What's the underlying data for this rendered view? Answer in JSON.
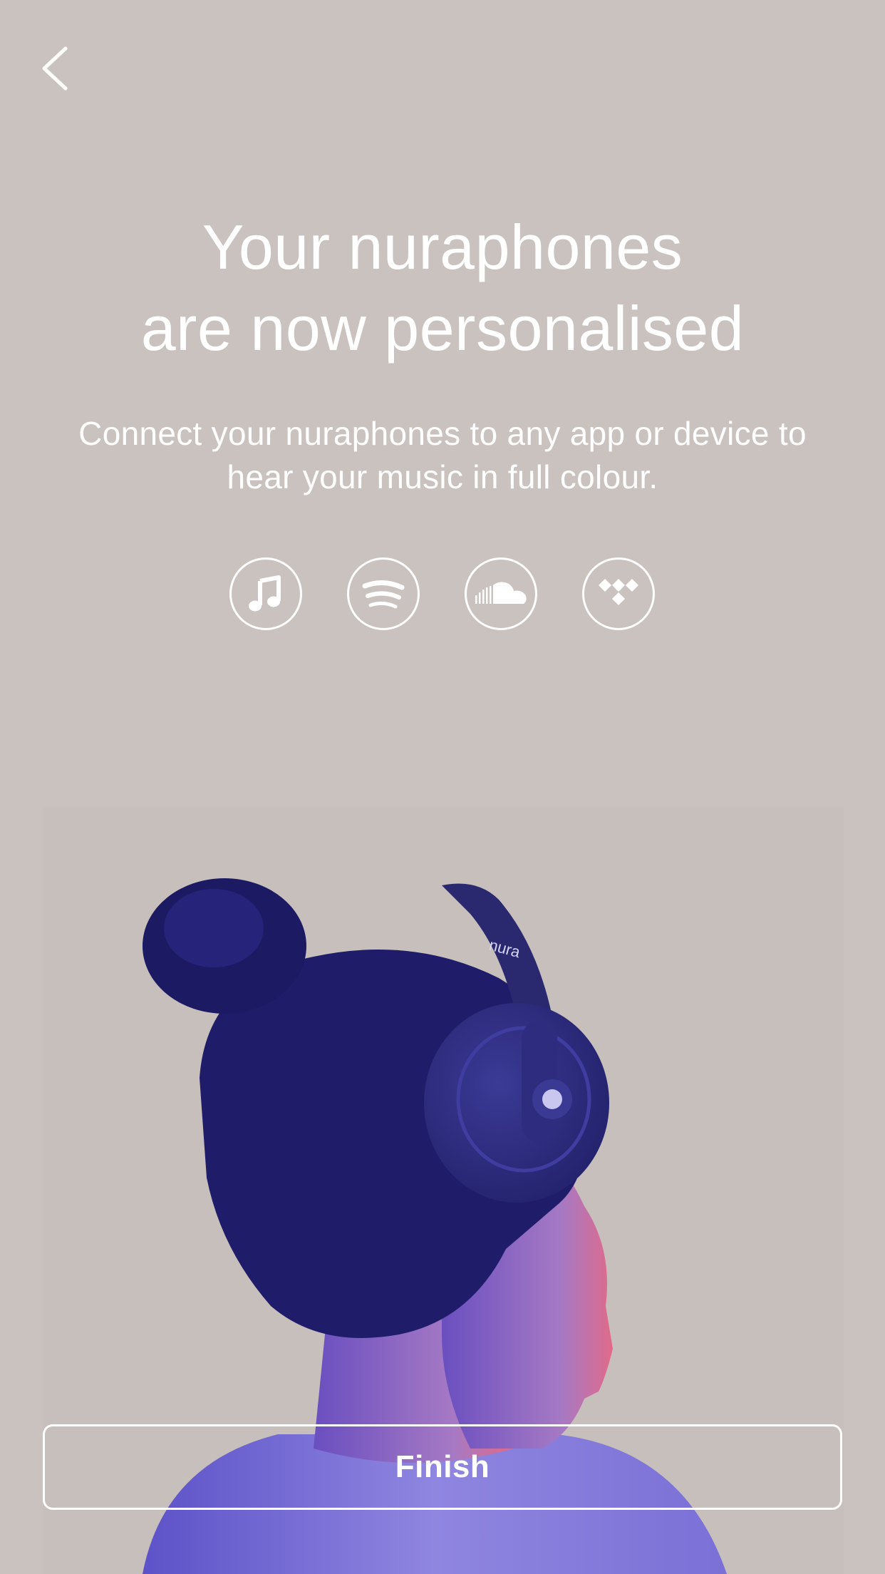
{
  "header": {
    "back_icon": "chevron-left-icon"
  },
  "title": {
    "line1": "Your nuraphones",
    "line2": "are now personalised"
  },
  "subtitle": {
    "line1": "Connect your nuraphones to any app or device to",
    "line2": "hear your music in full colour."
  },
  "services": [
    {
      "icon": "apple-music-icon"
    },
    {
      "icon": "spotify-icon"
    },
    {
      "icon": "soundcloud-icon"
    },
    {
      "icon": "tidal-icon"
    }
  ],
  "hero": {
    "headband_text": "nura"
  },
  "footer": {
    "finish_label": "Finish"
  },
  "colors": {
    "background": "#cac2bf",
    "foreground": "#ffffff",
    "headphones": "#2c2b78",
    "hair": "#1f1d6a"
  }
}
